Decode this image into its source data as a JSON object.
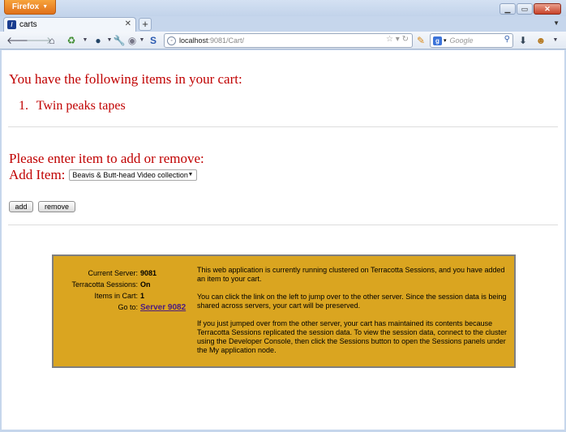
{
  "browser": {
    "app_button": "Firefox",
    "tab_title": "carts",
    "url_host": "localhost",
    "url_rest": ":9081/Cart/",
    "search_placeholder": "Google"
  },
  "page": {
    "cart_heading": "You have the following items in your cart:",
    "cart_items": [
      {
        "number": "1.",
        "name": "Twin peaks tapes"
      }
    ],
    "prompt_heading": "Please enter item to add or remove:",
    "add_item_label": "Add Item:",
    "selected_item": "Beavis & Butt-head Video collection",
    "add_button": "add",
    "remove_button": "remove"
  },
  "cluster_info": {
    "current_server_label": "Current Server:",
    "current_server": "9081",
    "sessions_label": "Terracotta Sessions:",
    "sessions": "On",
    "items_label": "Items in Cart:",
    "items_count": "1",
    "goto_label": "Go to:",
    "goto_link": "Server 9082",
    "paragraphs": [
      "This web application is currently running clustered on Terracotta Sessions, and you have added an item to your cart.",
      "You can click the link on the left to jump over to the other server.  Since the session data is being shared across servers, your cart will be preserved.",
      "If you just jumped over from the other server, your cart has maintained its contents because Terracotta Sessions replicated the session data. To view the session data, connect to the cluster using the Developer Console, then click the Sessions button to open the Sessions panels under the My application node."
    ],
    "box_color": "#daa520"
  },
  "colors": {
    "heading_red": "#c00000"
  }
}
